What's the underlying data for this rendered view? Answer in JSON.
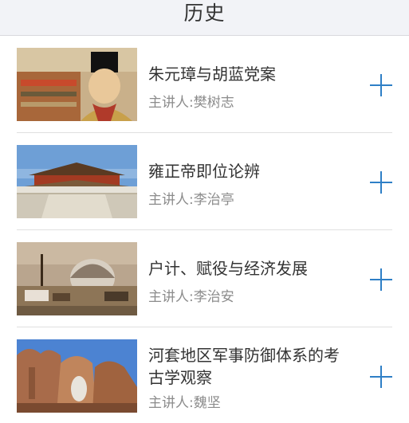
{
  "header": {
    "title": "历史"
  },
  "items": [
    {
      "title": "朱元璋与胡蓝党案",
      "speaker": "主讲人:樊树志"
    },
    {
      "title": "雍正帝即位论辨",
      "speaker": "主讲人:李治亭"
    },
    {
      "title": "户计、赋役与经济发展",
      "speaker": "主讲人:李治安"
    },
    {
      "title": "河套地区军事防御体系的考古学观察",
      "speaker": "主讲人:魏坚"
    }
  ],
  "colors": {
    "accent": "#2e7fc6",
    "header_bg": "#f2f3f7",
    "speaker_text": "#8c8c8c"
  },
  "icons": {
    "add": "plus-icon"
  }
}
